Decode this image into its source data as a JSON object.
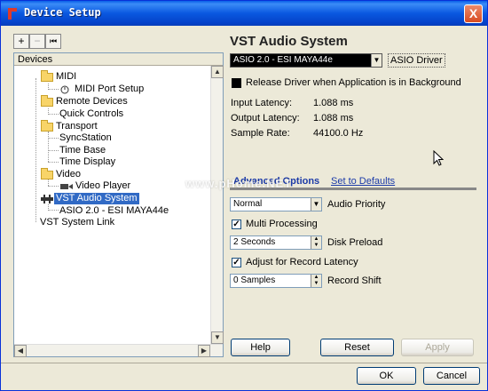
{
  "window": {
    "title": "Device Setup",
    "close_label": "X"
  },
  "toolbar": {
    "add": "+",
    "remove": "−",
    "reset": "⏮"
  },
  "devices_panel": {
    "header": "Devices",
    "items": [
      {
        "label": "MIDI"
      },
      {
        "label": "MIDI Port Setup"
      },
      {
        "label": "Remote Devices"
      },
      {
        "label": "Quick Controls"
      },
      {
        "label": "Transport"
      },
      {
        "label": "SyncStation"
      },
      {
        "label": "Time Base"
      },
      {
        "label": "Time Display"
      },
      {
        "label": "Video"
      },
      {
        "label": "Video Player"
      },
      {
        "label": "VST Audio System"
      },
      {
        "label": "ASIO 2.0 - ESI MAYA44e"
      },
      {
        "label": "VST System Link"
      }
    ]
  },
  "vst": {
    "title": "VST Audio System",
    "driver_value": "ASIO 2.0 - ESI MAYA44e",
    "driver_label": "ASIO Driver",
    "release_driver_label": "Release Driver when Application is in Background",
    "input_latency_label": "Input Latency:",
    "input_latency_value": "1.088 ms",
    "output_latency_label": "Output Latency:",
    "output_latency_value": "1.088 ms",
    "sample_rate_label": "Sample Rate:",
    "sample_rate_value": "44100.0 Hz",
    "advanced_tab": "Advanced Options",
    "defaults_link": "Set to Defaults",
    "audio_priority_value": "Normal",
    "audio_priority_label": "Audio Priority",
    "multi_processing_label": "Multi Processing",
    "disk_preload_value": "2 Seconds",
    "disk_preload_label": "Disk Preload",
    "adjust_record_label": "Adjust for Record Latency",
    "record_shift_value": "0 Samples",
    "record_shift_label": "Record Shift"
  },
  "watermark": "www.pHome.NET",
  "buttons": {
    "help": "Help",
    "reset": "Reset",
    "apply": "Apply",
    "ok": "OK",
    "cancel": "Cancel"
  },
  "colors": {
    "title_bar": "#0a58e0",
    "selection": "#316ac5",
    "dialog_bg": "#ece9d8"
  }
}
